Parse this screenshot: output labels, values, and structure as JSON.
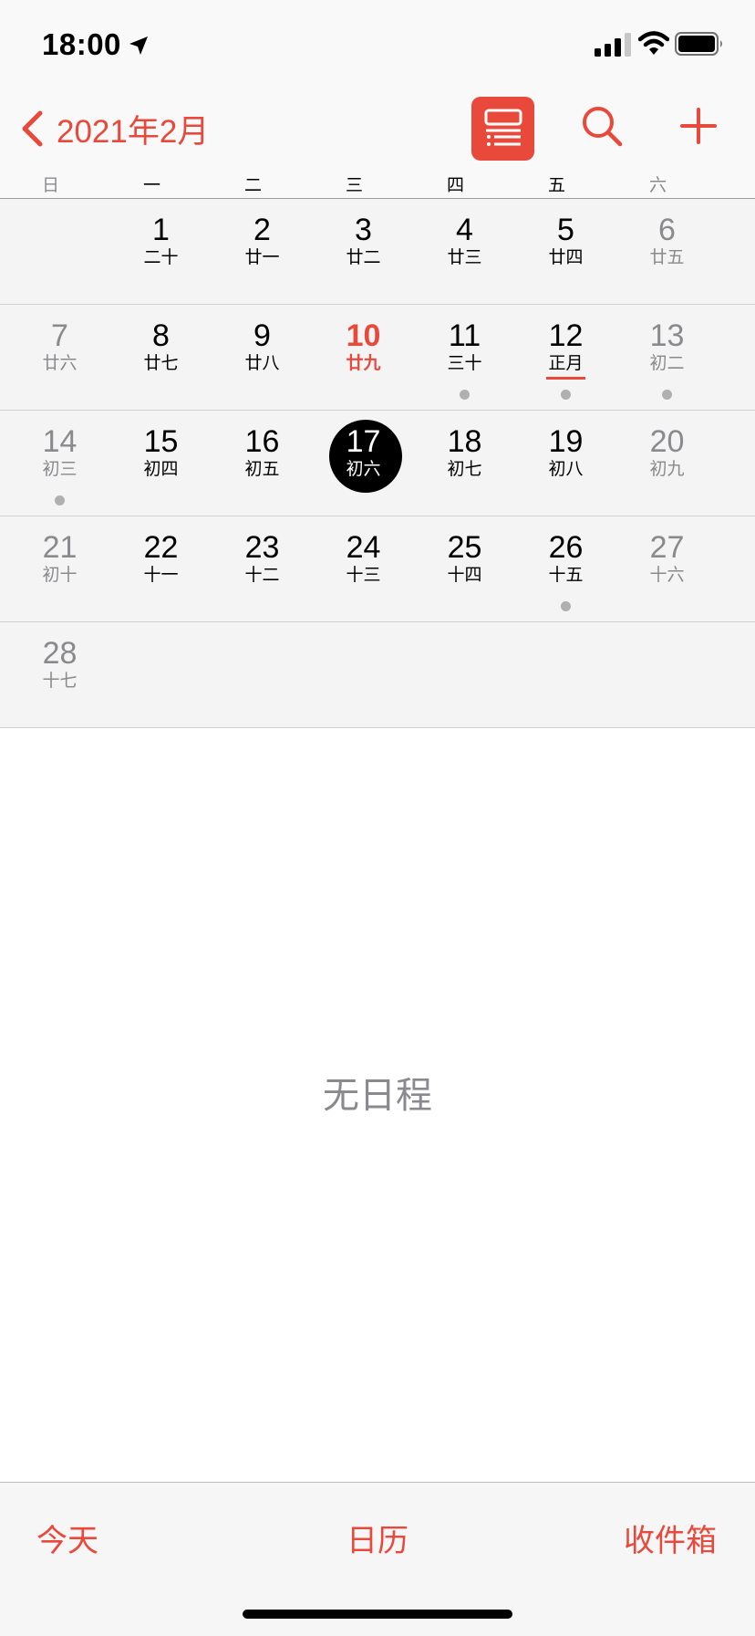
{
  "status_bar": {
    "time": "18:00",
    "icons": [
      "location-arrow-icon",
      "cellular-signal-icon",
      "wifi-icon",
      "battery-icon"
    ]
  },
  "nav": {
    "back_label": "2021年2月",
    "accent_color": "#e8493b"
  },
  "weekdays": [
    "日",
    "一",
    "二",
    "三",
    "四",
    "五",
    "六"
  ],
  "weeks": [
    [
      null,
      {
        "day": "1",
        "lunar": "二十"
      },
      {
        "day": "2",
        "lunar": "廿一"
      },
      {
        "day": "3",
        "lunar": "廿二"
      },
      {
        "day": "4",
        "lunar": "廿三"
      },
      {
        "day": "5",
        "lunar": "廿四"
      },
      {
        "day": "6",
        "lunar": "廿五"
      }
    ],
    [
      {
        "day": "7",
        "lunar": "廿六"
      },
      {
        "day": "8",
        "lunar": "廿七"
      },
      {
        "day": "9",
        "lunar": "廿八"
      },
      {
        "day": "10",
        "lunar": "廿九",
        "today": true
      },
      {
        "day": "11",
        "lunar": "三十",
        "has_event": true
      },
      {
        "day": "12",
        "lunar": "正月",
        "has_event": true,
        "lunar_new_month": true
      },
      {
        "day": "13",
        "lunar": "初二",
        "has_event": true
      }
    ],
    [
      {
        "day": "14",
        "lunar": "初三",
        "has_event": true
      },
      {
        "day": "15",
        "lunar": "初四"
      },
      {
        "day": "16",
        "lunar": "初五"
      },
      {
        "day": "17",
        "lunar": "初六",
        "selected": true
      },
      {
        "day": "18",
        "lunar": "初七"
      },
      {
        "day": "19",
        "lunar": "初八"
      },
      {
        "day": "20",
        "lunar": "初九"
      }
    ],
    [
      {
        "day": "21",
        "lunar": "初十"
      },
      {
        "day": "22",
        "lunar": "十一"
      },
      {
        "day": "23",
        "lunar": "十二"
      },
      {
        "day": "24",
        "lunar": "十三"
      },
      {
        "day": "25",
        "lunar": "十四"
      },
      {
        "day": "26",
        "lunar": "十五",
        "has_event": true
      },
      {
        "day": "27",
        "lunar": "十六"
      }
    ],
    [
      {
        "day": "28",
        "lunar": "十七"
      },
      null,
      null,
      null,
      null,
      null,
      null
    ]
  ],
  "empty_message": "无日程",
  "toolbar": {
    "today": "今天",
    "calendars": "日历",
    "inbox": "收件箱"
  }
}
